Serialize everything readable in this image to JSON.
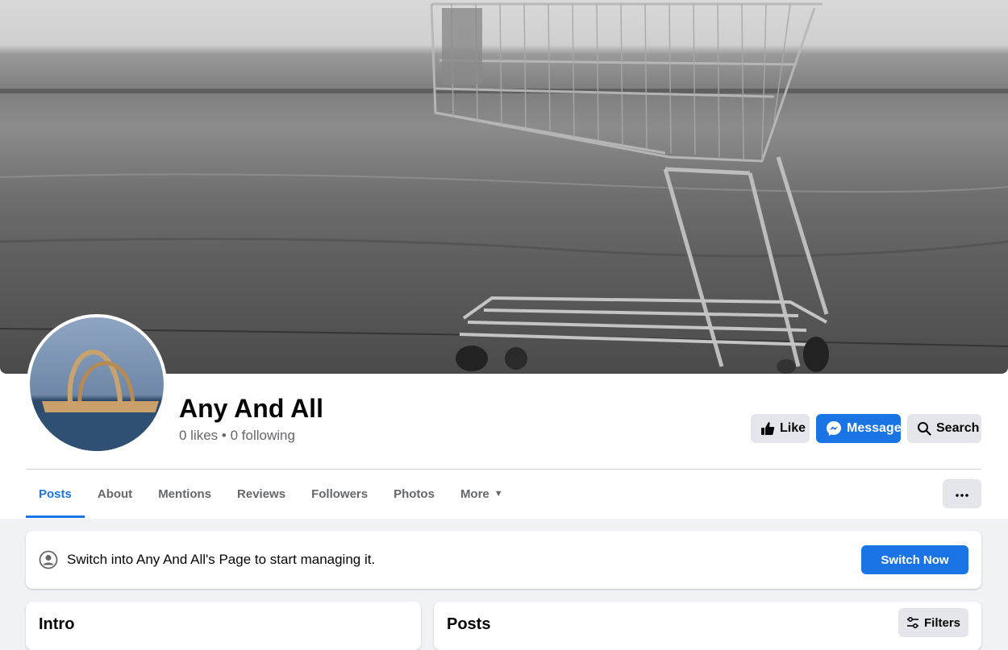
{
  "page": {
    "name": "Any And All",
    "stats": "0 likes • 0 following"
  },
  "actions": {
    "like": "Like",
    "message": "Message",
    "search": "Search"
  },
  "tabs": [
    {
      "label": "Posts",
      "active": true
    },
    {
      "label": "About"
    },
    {
      "label": "Mentions"
    },
    {
      "label": "Reviews"
    },
    {
      "label": "Followers"
    },
    {
      "label": "Photos"
    },
    {
      "label": "More"
    }
  ],
  "notice": {
    "text": "Switch into Any And All's Page to start managing it.",
    "button": "Switch Now"
  },
  "intro": {
    "title": "Intro"
  },
  "posts": {
    "title": "Posts",
    "filters": "Filters"
  },
  "colors": {
    "accent": "#1b74e4",
    "secondary_button": "#e4e6eb",
    "page_background": "#f0f2f5",
    "secondary_text": "#65676b"
  }
}
